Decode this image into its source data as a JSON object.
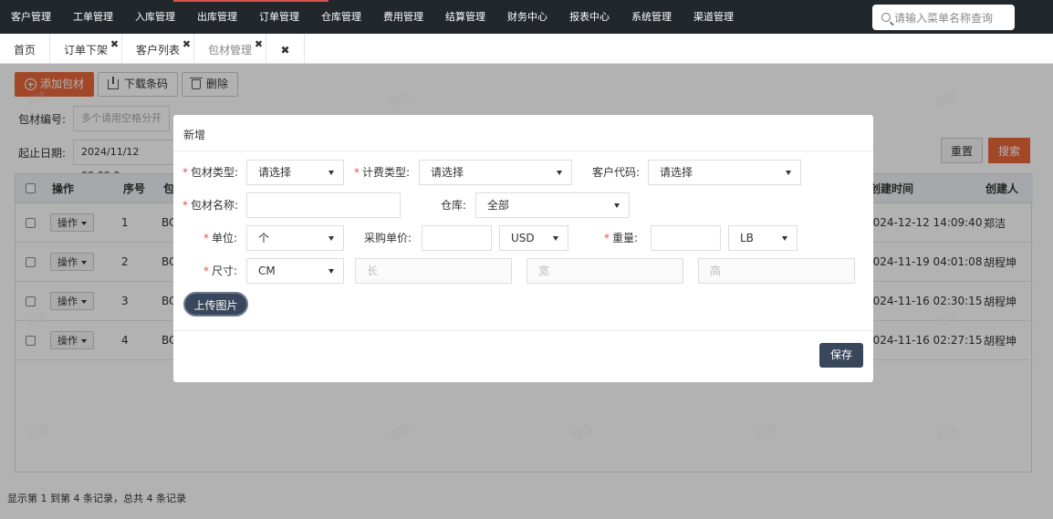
{
  "topnav": {
    "items": [
      "客户管理",
      "工单管理",
      "入库管理",
      "出库管理",
      "订单管理",
      "仓库管理",
      "费用管理",
      "结算管理",
      "财务中心",
      "报表中心",
      "系统管理",
      "渠道管理"
    ],
    "search_placeholder": "请输入菜单名称查询"
  },
  "tabs": [
    {
      "label": "首页"
    },
    {
      "label": "订单下架",
      "close": "✖"
    },
    {
      "label": "客户列表",
      "close": "✖"
    },
    {
      "label": "包材管理",
      "close": "✖"
    },
    {
      "label": "✖"
    }
  ],
  "toolbar": {
    "add": "添加包材",
    "download": "下载条码",
    "delete": "删除"
  },
  "filters": {
    "code_label": "包材编号:",
    "code_placeholder": "多个请用空格分开",
    "date_label": "起止日期:",
    "date_value": "2024/11/12 00:00:0",
    "reset": "重置",
    "search": "搜索"
  },
  "table": {
    "headers": {
      "op": "操作",
      "seq": "序号",
      "col3": "包",
      "created": "创建时间",
      "creator": "创建人"
    },
    "op_label": "操作",
    "rows": [
      {
        "seq": "1",
        "code": "BC",
        "created": "2024-12-12 14:09:40",
        "creator": "郑洁"
      },
      {
        "seq": "2",
        "code": "BC",
        "created": "2024-11-19 04:01:08",
        "creator": "胡程坤"
      },
      {
        "seq": "3",
        "code": "BC",
        "created": "2024-11-16 02:30:15",
        "creator": "胡程坤"
      },
      {
        "seq": "4",
        "code": "BC",
        "created": "2024-11-16 02:27:15",
        "creator": "胡程坤"
      }
    ]
  },
  "footer": "显示第 1 到第 4 条记录，总共 4 条记录",
  "watermark": "郑洁",
  "modal": {
    "title": "新增",
    "packaging_type_label": "包材类型:",
    "packaging_type_value": "请选择",
    "billing_type_label": "计费类型:",
    "billing_type_value": "请选择",
    "customer_code_label": "客户代码:",
    "customer_code_value": "请选择",
    "name_label": "包材名称:",
    "warehouse_label": "仓库:",
    "warehouse_value": "全部",
    "unit_label": "单位:",
    "unit_value": "个",
    "price_label": "采购单价:",
    "currency_value": "USD",
    "weight_label": "重量:",
    "weight_unit_value": "LB",
    "size_label": "尺寸:",
    "size_unit_value": "CM",
    "length_placeholder": "长",
    "width_placeholder": "宽",
    "height_placeholder": "高",
    "upload": "上传图片",
    "save": "保存"
  },
  "colors": {
    "accent": "#e8673c",
    "nav_bg": "#22272c",
    "primary_btn": "#38475c"
  }
}
